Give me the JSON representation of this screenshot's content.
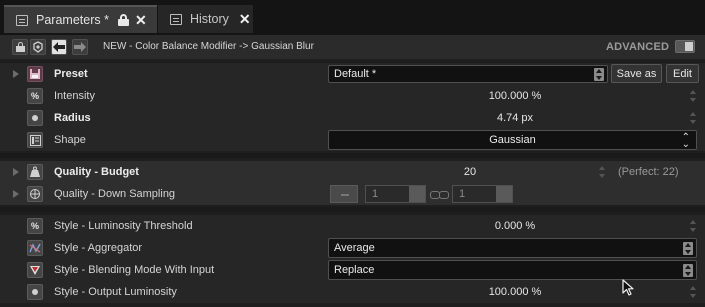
{
  "tabs": [
    {
      "label": "Parameters *",
      "active": true
    },
    {
      "label": "History",
      "active": false
    }
  ],
  "toolbar": {
    "breadcrumb": "NEW - Color Balance Modifier -> Gaussian Blur",
    "advanced_label": "ADVANCED"
  },
  "rows": {
    "preset": {
      "label": "Preset",
      "value": "Default *",
      "save_as": "Save as",
      "edit": "Edit"
    },
    "intensity": {
      "label": "Intensity",
      "value": "100.000 %"
    },
    "radius": {
      "label": "Radius",
      "value": "4.74 px"
    },
    "shape": {
      "label": "Shape",
      "value": "Gaussian"
    },
    "quality_budget": {
      "label": "Quality - Budget",
      "value": "20",
      "hint": "(Perfect: 22)"
    },
    "quality_down": {
      "label": "Quality - Down Sampling",
      "value_a": "1",
      "value_b": "1"
    },
    "lum_threshold": {
      "label": "Style - Luminosity Threshold",
      "value": "0.000 %"
    },
    "aggregator": {
      "label": "Style - Aggregator",
      "value": "Average"
    },
    "blending": {
      "label": "Style - Blending Mode With Input",
      "value": "Replace"
    },
    "output_lum": {
      "label": "Style - Output Luminosity",
      "value": "100.000 %"
    }
  },
  "colors": {
    "background": "#1e1e1e",
    "tab_active": "#3a3a3a",
    "dropdown_bg": "#111111"
  }
}
